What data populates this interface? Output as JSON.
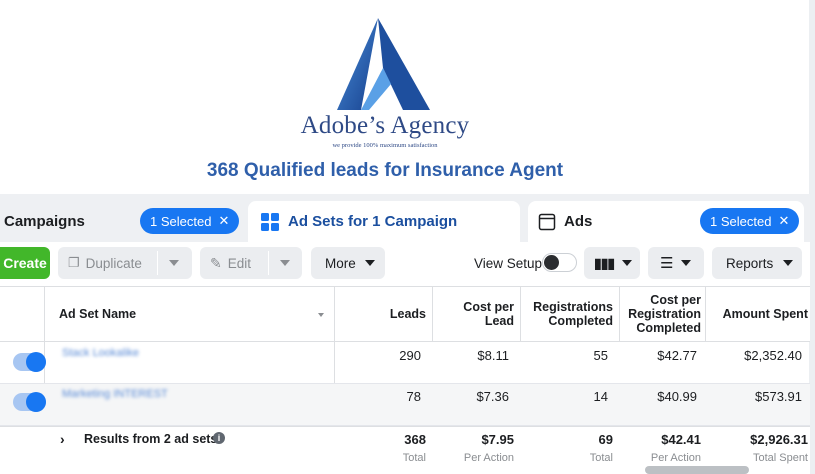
{
  "brand": {
    "name": "Adobe’s Agency",
    "tagline": "we provide 100% maximum satisfaction",
    "headline": "368  Qualified leads for Insurance Agent",
    "logo_colors": [
      "#1b4b9b",
      "#3f86d6"
    ]
  },
  "tabs": {
    "campaigns": {
      "label": "Campaigns",
      "selected": "1 Selected"
    },
    "adsets": {
      "label": "Ad Sets for 1 Campaign",
      "icon": "grid-icon"
    },
    "ads": {
      "label": "Ads",
      "selected": "1 Selected",
      "icon": "ad-frame-icon"
    }
  },
  "toolbar": {
    "create": "Create",
    "duplicate": "Duplicate",
    "edit": "Edit",
    "more": "More",
    "view_setup": "View Setup",
    "reports": "Reports",
    "icons": [
      "columns-icon",
      "breakdown-icon"
    ]
  },
  "table": {
    "headers": {
      "name": "Ad Set Name",
      "leads": [
        "Leads"
      ],
      "cpl": [
        "Cost per",
        "Lead"
      ],
      "reg": [
        "Registrations",
        "Completed"
      ],
      "cpr": [
        "Cost per",
        "Registration",
        "Completed"
      ],
      "spent": [
        "Amount Spent"
      ]
    },
    "rows": [
      {
        "name": "Stack Lookalike",
        "leads": "290",
        "cpl": "$8.11",
        "reg": "55",
        "cpr": "$42.77",
        "spent": "$2,352.40",
        "on": true
      },
      {
        "name": "Marketing INTEREST",
        "leads": "78",
        "cpl": "$7.36",
        "reg": "14",
        "cpr": "$40.99",
        "spent": "$573.91",
        "on": true
      }
    ],
    "totals": {
      "label": "Results from 2 ad sets",
      "leads": "368",
      "leads_sub": "Total",
      "cpl": "$7.95",
      "cpl_sub": "Per Action",
      "reg": "69",
      "reg_sub": "Total",
      "cpr": "$42.41",
      "cpr_sub": "Per Action",
      "spent": "$2,926.31",
      "spent_sub": "Total Spent"
    }
  },
  "colors": {
    "accent": "#1877f2",
    "create_green": "#42b72a",
    "headline_blue": "#2f5faa"
  }
}
